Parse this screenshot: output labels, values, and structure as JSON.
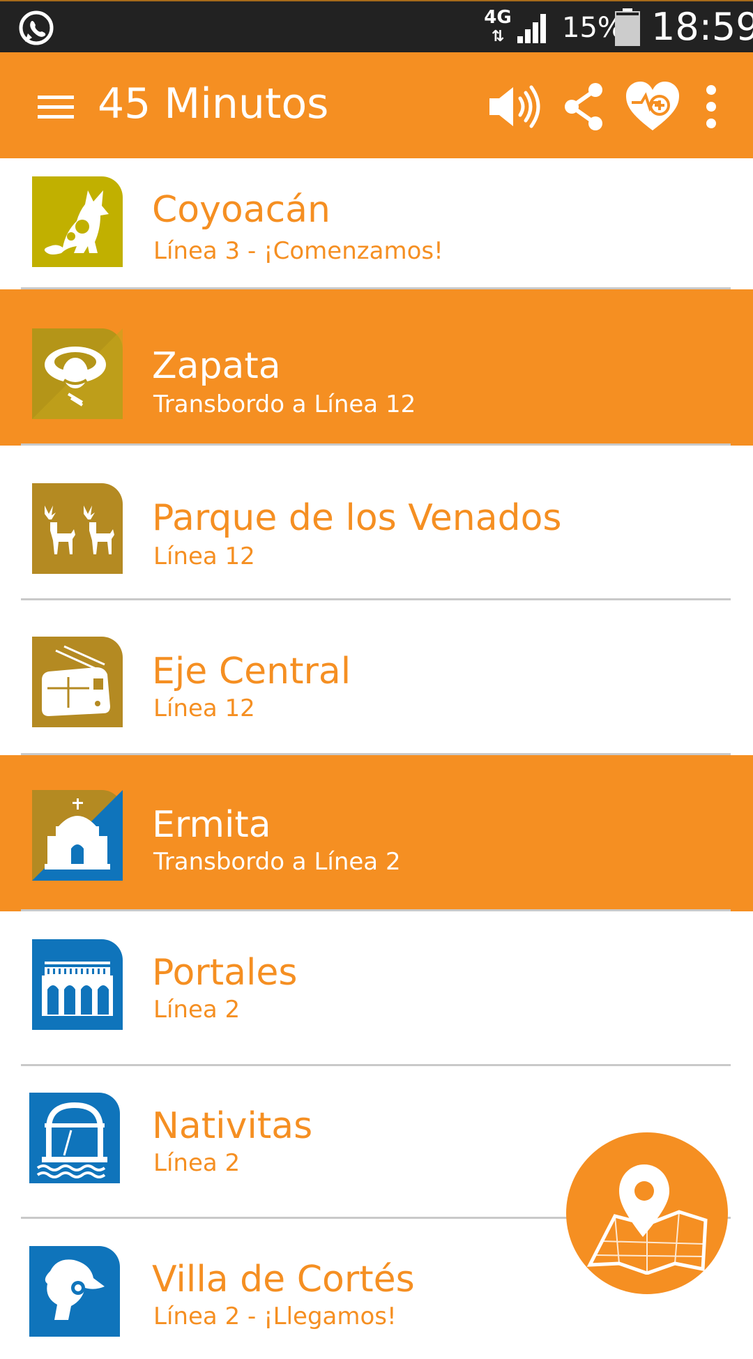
{
  "status_bar": {
    "network": "4G",
    "battery": "15%",
    "time": "18:59",
    "notification_icon": "whatsapp-icon"
  },
  "app_bar": {
    "title": "45 Minutos",
    "actions": [
      "menu-icon",
      "volume-icon",
      "share-icon",
      "favorite-heart-icon",
      "more-vert-icon"
    ]
  },
  "stations": [
    {
      "name": "Coyoacán",
      "line": "Línea 3 - ¡Comenzamos!",
      "highlight": false,
      "icon": "coyote-icon",
      "icon_color": "#c1b000"
    },
    {
      "name": "Zapata",
      "line": "Transbordo a Línea 12",
      "highlight": true,
      "icon": "zapata-icon",
      "icon_color": "#b49518"
    },
    {
      "name": "Parque de los Venados",
      "line": "Línea 12",
      "highlight": false,
      "icon": "deer-icon",
      "icon_color": "#b48a22"
    },
    {
      "name": "Eje Central",
      "line": "Línea 12",
      "highlight": false,
      "icon": "trolleybus-icon",
      "icon_color": "#b48a22"
    },
    {
      "name": "Ermita",
      "line": "Transbordo a Línea 2",
      "highlight": true,
      "icon": "chapel-icon",
      "icon_color": "#b48a22"
    },
    {
      "name": "Portales",
      "line": "Línea 2",
      "highlight": false,
      "icon": "arches-icon",
      "icon_color": "#0f74bb"
    },
    {
      "name": "Nativitas",
      "line": "Línea 2",
      "highlight": false,
      "icon": "kiosk-icon",
      "icon_color": "#0f74bb"
    },
    {
      "name": "Villa de Cortés",
      "line": "Línea 2 - ¡Llegamos!",
      "highlight": false,
      "icon": "cortes-helmet-icon",
      "icon_color": "#0f74bb"
    }
  ],
  "colors": {
    "accent": "#f58f22",
    "status_bar": "#222222",
    "line12_gold": "#b48a22",
    "line3_olive": "#c1b000",
    "line2_blue": "#0f74bb",
    "divider": "#c9c9c9"
  },
  "fab": {
    "icon": "map-pin-icon"
  }
}
